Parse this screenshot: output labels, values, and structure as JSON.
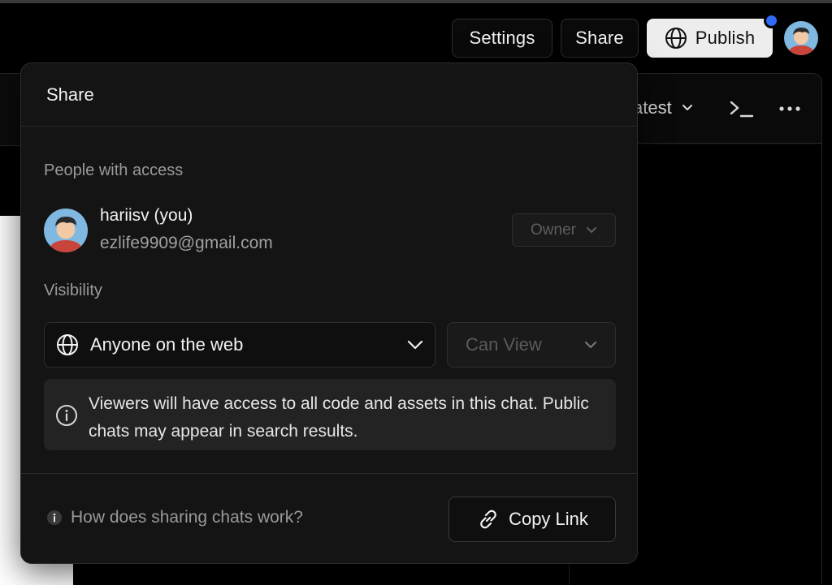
{
  "topbar": {
    "settings_label": "Settings",
    "share_label": "Share",
    "publish_label": "Publish"
  },
  "editor": {
    "version_label": "atest"
  },
  "share_dialog": {
    "title": "Share",
    "people_label": "People with access",
    "user": {
      "name": "hariisv (you)",
      "email": "ezlife9909@gmail.com",
      "role": "Owner"
    },
    "visibility_label": "Visibility",
    "visibility_value": "Anyone on the web",
    "permission_value": "Can View",
    "info_text": "Viewers will have access to all code and assets in this chat. Public chats may appear in search results.",
    "help_link": "How does sharing chats work?",
    "copy_link_label": "Copy Link"
  },
  "colors": {
    "background": "#000000",
    "popover": "#141414",
    "notification_dot": "#2f6bf2",
    "publish_button": "#ededed"
  }
}
